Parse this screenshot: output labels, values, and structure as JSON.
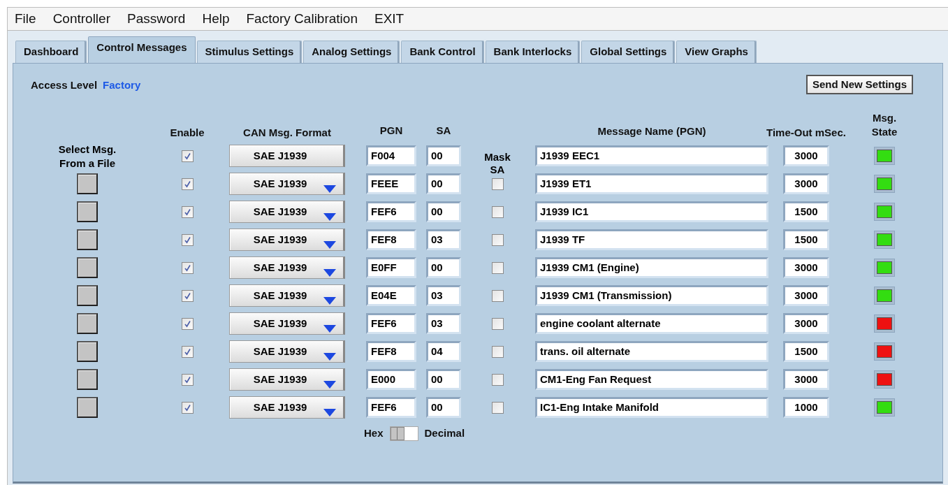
{
  "menu": [
    "File",
    "Controller",
    "Password",
    "Help",
    "Factory Calibration",
    "EXIT"
  ],
  "tabs": [
    {
      "label": "Dashboard",
      "selected": false
    },
    {
      "label": "Control Messages",
      "selected": true
    },
    {
      "label": "Stimulus Settings",
      "selected": false
    },
    {
      "label": "Analog Settings",
      "selected": false
    },
    {
      "label": "Bank Control",
      "selected": false
    },
    {
      "label": "Bank Interlocks",
      "selected": false
    },
    {
      "label": "Global Settings",
      "selected": false
    },
    {
      "label": "View Graphs",
      "selected": false
    }
  ],
  "access": {
    "label": "Access Level",
    "value": "Factory"
  },
  "send_button": "Send New Settings",
  "headers": {
    "select": "Select Msg. From a File",
    "enable": "Enable",
    "format": "CAN Msg. Format",
    "pgn": "PGN",
    "sa": "SA",
    "mask": "Mask SA",
    "name": "Message Name (PGN)",
    "timeout": "Time-Out mSec.",
    "state": "Msg. State"
  },
  "rows": [
    {
      "kind": "fixed",
      "enabled": true,
      "format": "SAE J1939",
      "pgn": "F004",
      "sa": "00",
      "name": "J1939 EEC1",
      "timeout": "3000",
      "color": "#33dd11"
    },
    {
      "kind": "file",
      "enabled": true,
      "format": "SAE J1939",
      "pgn": "FEEE",
      "sa": "00",
      "masked": false,
      "name": "J1939 ET1",
      "timeout": "3000",
      "color": "#33dd11"
    },
    {
      "kind": "file",
      "enabled": true,
      "format": "SAE J1939",
      "pgn": "FEF6",
      "sa": "00",
      "masked": false,
      "name": "J1939 IC1",
      "timeout": "1500",
      "color": "#33dd11"
    },
    {
      "kind": "file",
      "enabled": true,
      "format": "SAE J1939",
      "pgn": "FEF8",
      "sa": "03",
      "masked": false,
      "name": "J1939 TF",
      "timeout": "1500",
      "color": "#33dd11"
    },
    {
      "kind": "file",
      "enabled": true,
      "format": "SAE J1939",
      "pgn": "E0FF",
      "sa": "00",
      "masked": false,
      "name": "J1939 CM1 (Engine)",
      "timeout": "3000",
      "color": "#33dd11"
    },
    {
      "kind": "file",
      "enabled": true,
      "format": "SAE J1939",
      "pgn": "E04E",
      "sa": "03",
      "masked": false,
      "name": "J1939 CM1 (Transmission)",
      "timeout": "3000",
      "color": "#33dd11"
    },
    {
      "kind": "file",
      "enabled": true,
      "format": "SAE J1939",
      "pgn": "FEF6",
      "sa": "03",
      "masked": false,
      "name": "engine coolant alternate",
      "timeout": "3000",
      "color": "#ee1111"
    },
    {
      "kind": "file",
      "enabled": true,
      "format": "SAE J1939",
      "pgn": "FEF8",
      "sa": "04",
      "masked": false,
      "name": "trans. oil alternate",
      "timeout": "1500",
      "color": "#ee1111"
    },
    {
      "kind": "file",
      "enabled": true,
      "format": "SAE J1939",
      "pgn": "E000",
      "sa": "00",
      "masked": false,
      "name": "CM1-Eng Fan Request",
      "timeout": "3000",
      "color": "#ee1111"
    },
    {
      "kind": "file",
      "enabled": true,
      "format": "SAE J1939",
      "pgn": "FEF6",
      "sa": "00",
      "masked": false,
      "name": "IC1-Eng Intake Manifold",
      "timeout": "1000",
      "color": "#33dd11"
    }
  ],
  "toggle": {
    "left": "Hex",
    "right": "Decimal",
    "decimal": false
  }
}
